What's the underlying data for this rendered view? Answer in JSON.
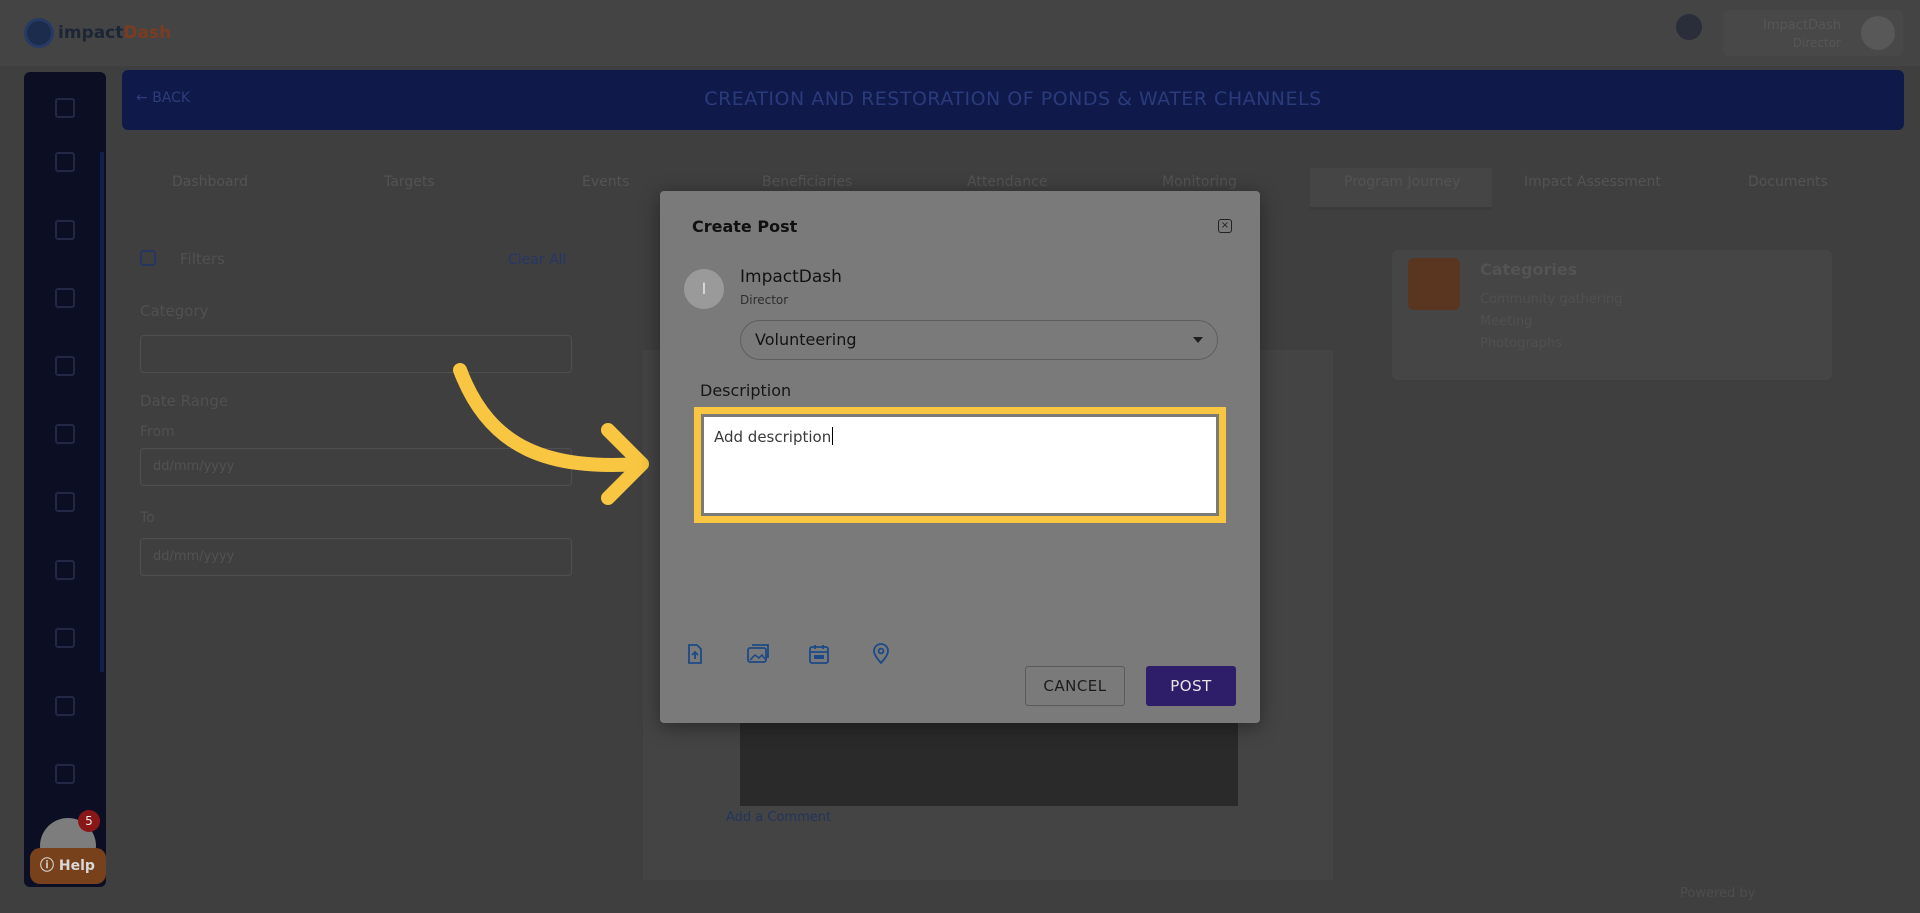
{
  "app": {
    "logo_text": "impact",
    "logo_accent": "Dash",
    "user_name": "ImpactDash",
    "user_role": "Director"
  },
  "banner": {
    "back_label": "BACK",
    "title": "CREATION AND RESTORATION OF PONDS & WATER CHANNELS"
  },
  "tabs": [
    {
      "label": "Dashboard"
    },
    {
      "label": "Targets"
    },
    {
      "label": "Events"
    },
    {
      "label": "Beneficiaries"
    },
    {
      "label": "Attendance"
    },
    {
      "label": "Monitoring"
    },
    {
      "label": "Program Journey"
    },
    {
      "label": "Impact Assessment"
    },
    {
      "label": "Documents"
    }
  ],
  "filters": {
    "title": "Filters",
    "clear_all": "Clear All",
    "category_label": "Category",
    "date_range_label": "Date Range",
    "from_label": "From",
    "to_label": "To",
    "from_placeholder": "dd/mm/yyyy",
    "to_placeholder": "dd/mm/yyyy"
  },
  "categories_panel": {
    "title": "Categories",
    "items": [
      "Community gathering",
      "Meeting",
      "Photographs"
    ]
  },
  "feed": {
    "add_comment": "Add a Comment"
  },
  "help": {
    "count": "5",
    "label": "Help"
  },
  "footer": {
    "powered_by": "Powered by"
  },
  "modal": {
    "title": "Create Post",
    "author_initial": "I",
    "author_name": "ImpactDash",
    "author_role": "Director",
    "category_value": "Volunteering",
    "description_label": "Description",
    "description_placeholder": "Add description",
    "cancel_label": "CANCEL",
    "post_label": "POST"
  },
  "colors": {
    "highlight": "#f8c641",
    "arrow": "#f8c641",
    "post_button": "#2e1e6a",
    "tool_icon": "#1c4a86"
  }
}
